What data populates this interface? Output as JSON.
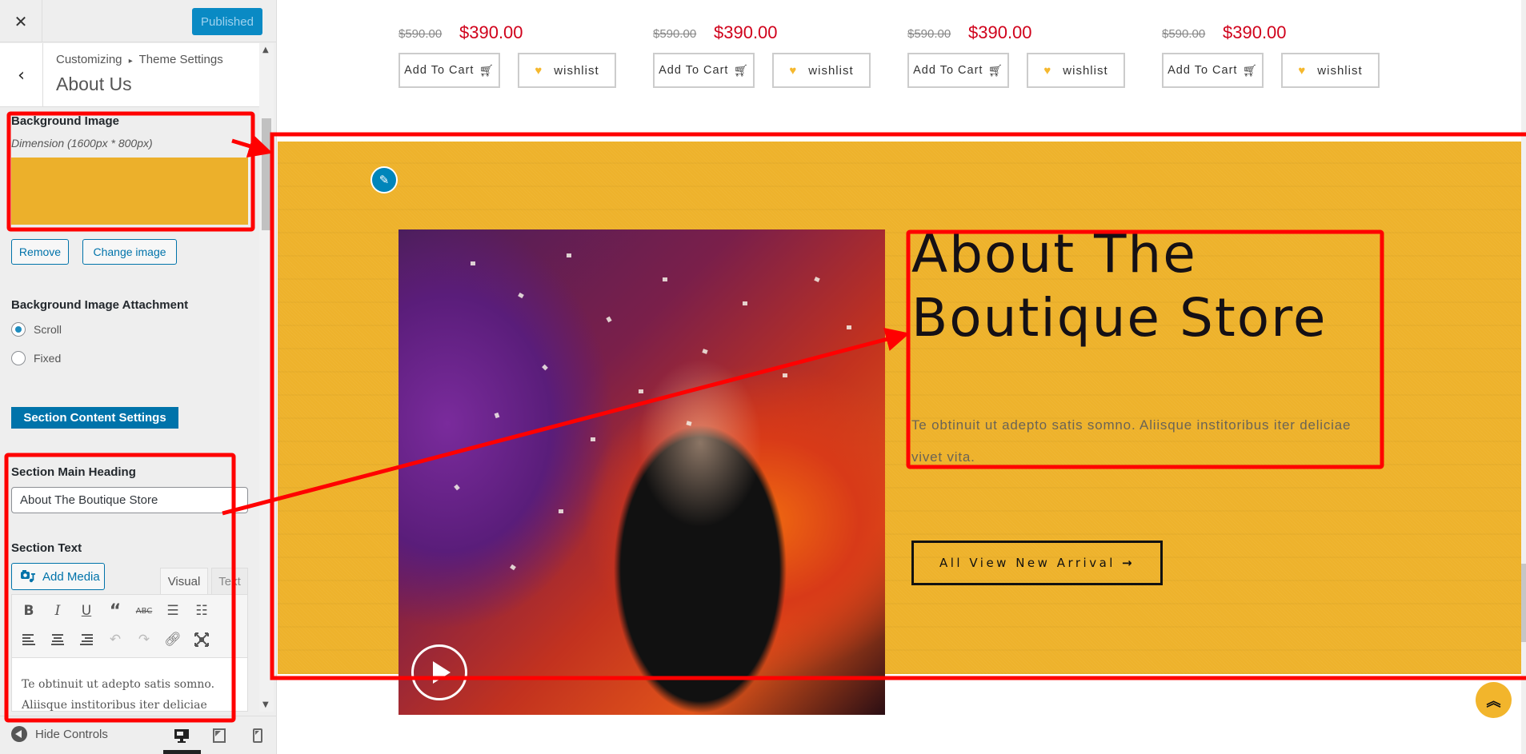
{
  "customizer": {
    "close_icon": "close-icon",
    "publish_label": "Published",
    "breadcrumb": "Customizing",
    "breadcrumb_sep": "▸",
    "breadcrumb_parent": "Theme Settings",
    "section_title": "About Us",
    "background_image": {
      "label": "Background Image",
      "description": "Dimension (1600px * 800px)",
      "preview_color": "#ecb02b",
      "remove_label": "Remove",
      "change_label": "Change image"
    },
    "attachment": {
      "label": "Background Image Attachment",
      "options": [
        {
          "label": "Scroll",
          "selected": true
        },
        {
          "label": "Fixed",
          "selected": false
        }
      ]
    },
    "content_settings_label": "Section Content Settings",
    "main_heading": {
      "label": "Section Main Heading",
      "value": "About The Boutique Store"
    },
    "section_text": {
      "label": "Section Text",
      "add_media_label": "Add Media",
      "tabs": [
        {
          "label": "Visual",
          "active": true
        },
        {
          "label": "Text",
          "active": false
        }
      ],
      "toolbar_row1": [
        "bold",
        "italic",
        "underline",
        "blockquote",
        "strikethrough",
        "bullet-list",
        "numbered-list"
      ],
      "toolbar_row2": [
        "align-left",
        "align-center",
        "align-right",
        "undo",
        "redo",
        "link",
        "fullscreen"
      ],
      "content_line1": "Te obtinuit ut adepto satis somno.",
      "content_line2": "Aliisque institoribus iter deliciae"
    },
    "footer": {
      "hide_controls_label": "Hide Controls",
      "devices": [
        "desktop",
        "tablet",
        "mobile"
      ],
      "active_device": "desktop"
    }
  },
  "preview": {
    "products": [
      {
        "old_price": "$590.00",
        "price": "$390.00",
        "cart_label": "Add To Cart",
        "wishlist_label": "wishlist"
      },
      {
        "old_price": "$590.00",
        "price": "$390.00",
        "cart_label": "Add To Cart",
        "wishlist_label": "wishlist"
      },
      {
        "old_price": "$590.00",
        "price": "$390.00",
        "cart_label": "Add To Cart",
        "wishlist_label": "wishlist"
      },
      {
        "old_price": "$590.00",
        "price": "$390.00",
        "cart_label": "Add To Cart",
        "wishlist_label": "wishlist"
      }
    ],
    "about": {
      "background_color": "#eeb22b",
      "heading_line1": "About The",
      "heading_line2": "Boutique Store",
      "text": "Te obtinuit ut adepto satis somno. Aliisque institoribus iter deliciae vivet vita.",
      "button_label": "All View New Arrival",
      "button_arrow": "→"
    },
    "back_to_top_icon": "double-chevron-up-icon"
  },
  "colors": {
    "accent_blue": "#0073aa",
    "publish_blue": "#0a8ac4",
    "price_red": "#d0021b",
    "annotation_red": "#ff0000",
    "wishlist_heart": "#f5b82e"
  }
}
